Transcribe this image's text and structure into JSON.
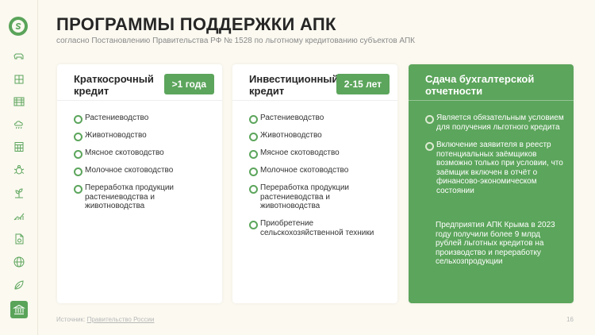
{
  "header": {
    "title": "ПРОГРАММЫ ПОДДЕРЖКИ АПК",
    "subtitle": "согласно Постановлению Правительства РФ № 1528 по льготному кредитованию субъектов АПК"
  },
  "sidebar": {
    "logo": "sber-logo-icon",
    "icons": [
      "cow-icon",
      "factory-icon",
      "field-icon",
      "weather-icon",
      "calendar-grid-icon",
      "bug-icon",
      "sprout-icon",
      "chart-leaf-icon",
      "document-icon",
      "globe-icon",
      "plant-icon",
      "bank-icon"
    ],
    "active_icon": "bank-icon"
  },
  "cards": [
    {
      "title": "Краткосрочный кредит",
      "badge": ">1 года",
      "items": [
        "Растениеводство",
        "Животноводство",
        "Мясное скотоводство",
        "Молочное скотоводство",
        "Переработка продукции растениеводства и животноводства"
      ]
    },
    {
      "title": "Инвестиционный кредит",
      "badge": "2-15 лет",
      "items": [
        "Растениеводство",
        "Животноводство",
        "Мясное скотоводство",
        "Молочное скотоводство",
        "Переработка продукции растениеводства и животноводства",
        "Приобретение сельскохозяйственной техники"
      ]
    },
    {
      "title": "Сдача бухгалтерской отчетности",
      "items": [
        "Является обязательным условием для получения льготного кредита",
        "Включение заявителя в реестр потенциальных заёмщиков возможно только при условии, что заёмщик включен в отчёт о финансово-экономическом состоянии"
      ],
      "note": "Предприятия АПК Крыма в 2023 году получили более 9 млрд рублей льготных кредитов на производство и переработку сельхозпродукции"
    }
  ],
  "footer": {
    "source_label": "Источник:",
    "source_link": "Правительство России",
    "page_number": "16"
  },
  "colors": {
    "accent": "#5ca55c",
    "background": "#fbf9f0",
    "card": "#ffffff"
  }
}
